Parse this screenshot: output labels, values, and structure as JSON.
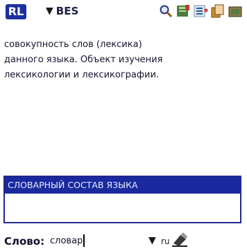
{
  "toolbar": {
    "app_badge": "RL",
    "dictionary": "BES",
    "icons": [
      "search-icon",
      "dictionary-book-icon",
      "list-icon",
      "copy-icon",
      "settings-icon"
    ]
  },
  "definition": {
    "lines": [
      "совокупность слов (лексика)",
      "данного языка. Объект изучения",
      "лексикологии и лексикографии."
    ]
  },
  "lookup": {
    "selected": "СЛОВАРНЫЙ СОСТАВ ЯЗЫКА"
  },
  "word_bar": {
    "label": "Слово:",
    "value": "словар",
    "lang": "ru"
  },
  "colors": {
    "accent": "#1a2a9e",
    "badge": "#1d2fa0"
  }
}
